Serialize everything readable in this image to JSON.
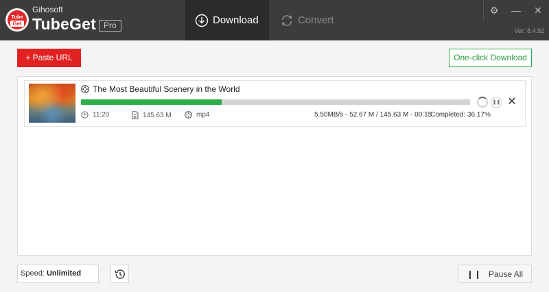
{
  "app": {
    "brand_small": "Gihosoft",
    "brand_big": "TubeGet",
    "edition": "Pro",
    "logo_top": "Tube",
    "logo_bottom": "Get",
    "version": "Ver: 8.4.92"
  },
  "tabs": [
    {
      "label": "Download",
      "icon": "download-circle-icon",
      "active": true
    },
    {
      "label": "Convert",
      "icon": "refresh-icon",
      "active": false
    }
  ],
  "window_controls": {
    "settings": "⚙",
    "minimize": "—",
    "close": "✕"
  },
  "toolbar": {
    "paste_url_label": "+ Paste URL",
    "one_click_label": "One-click Download"
  },
  "downloads": [
    {
      "title": "The Most Beautiful Scenery in the World",
      "duration": "11:20",
      "size": "145.63 M",
      "format": "mp4",
      "progress": 0.3617,
      "transfer": "5.50MB/s - 52.67 M / 145.63 M - 00:15",
      "completed": "Completed:  36.17%"
    }
  ],
  "footer": {
    "speed_label": "Speed:",
    "speed_value": "Unlimited",
    "pause_all_label": "Pause All"
  },
  "colors": {
    "accent_red": "#e12222",
    "accent_green": "#2eae4b",
    "titlebar": "#3c3c3c"
  }
}
